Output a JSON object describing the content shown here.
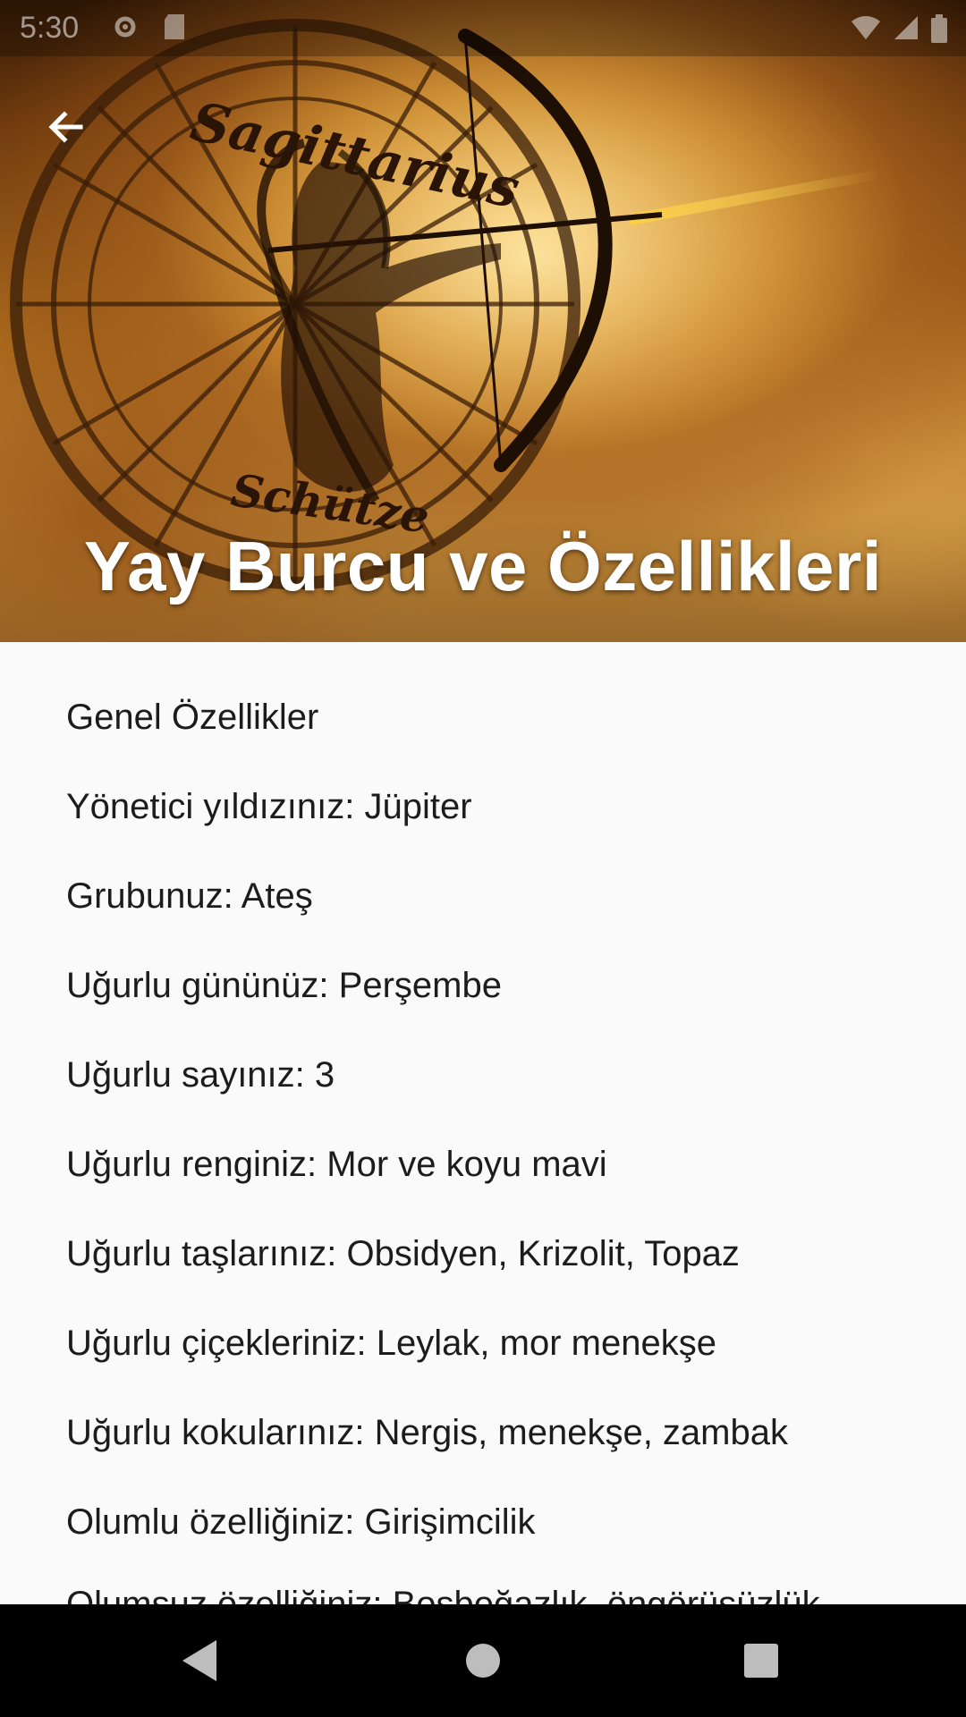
{
  "status_bar": {
    "time": "5:30"
  },
  "header": {
    "title": "Yay Burcu ve Özellikleri",
    "image_text_top": "Sagittarius",
    "image_text_bottom": "Schütze"
  },
  "content": {
    "lines": [
      "Genel Özellikler",
      " Yönetici yıldızınız: Jüpiter",
      " Grubunuz: Ateş",
      " Uğurlu gününüz: Perşembe",
      " Uğurlu sayınız: 3",
      " Uğurlu renginiz: Mor ve koyu mavi",
      " Uğurlu taşlarınız: Obsidyen, Krizolit, Topaz",
      "Uğurlu çiçekleriniz: Leylak, mor menekşe",
      "  Uğurlu kokularınız: Nergis, menekşe, zambak",
      "  Olumlu özelliğiniz: Girişimcilik",
      "  Olumsuz özelliğiniz: Boşboğazlık, öngörüsüzlük"
    ]
  },
  "icons": {
    "back": "arrow-back-icon",
    "nav_back": "triangle-back-icon",
    "nav_home": "circle-home-icon",
    "nav_recents": "square-recents-icon"
  },
  "colors": {
    "background": "#fafafa",
    "text": "#1c1c1c",
    "title": "#ffffff",
    "nav_bar": "#000000"
  }
}
